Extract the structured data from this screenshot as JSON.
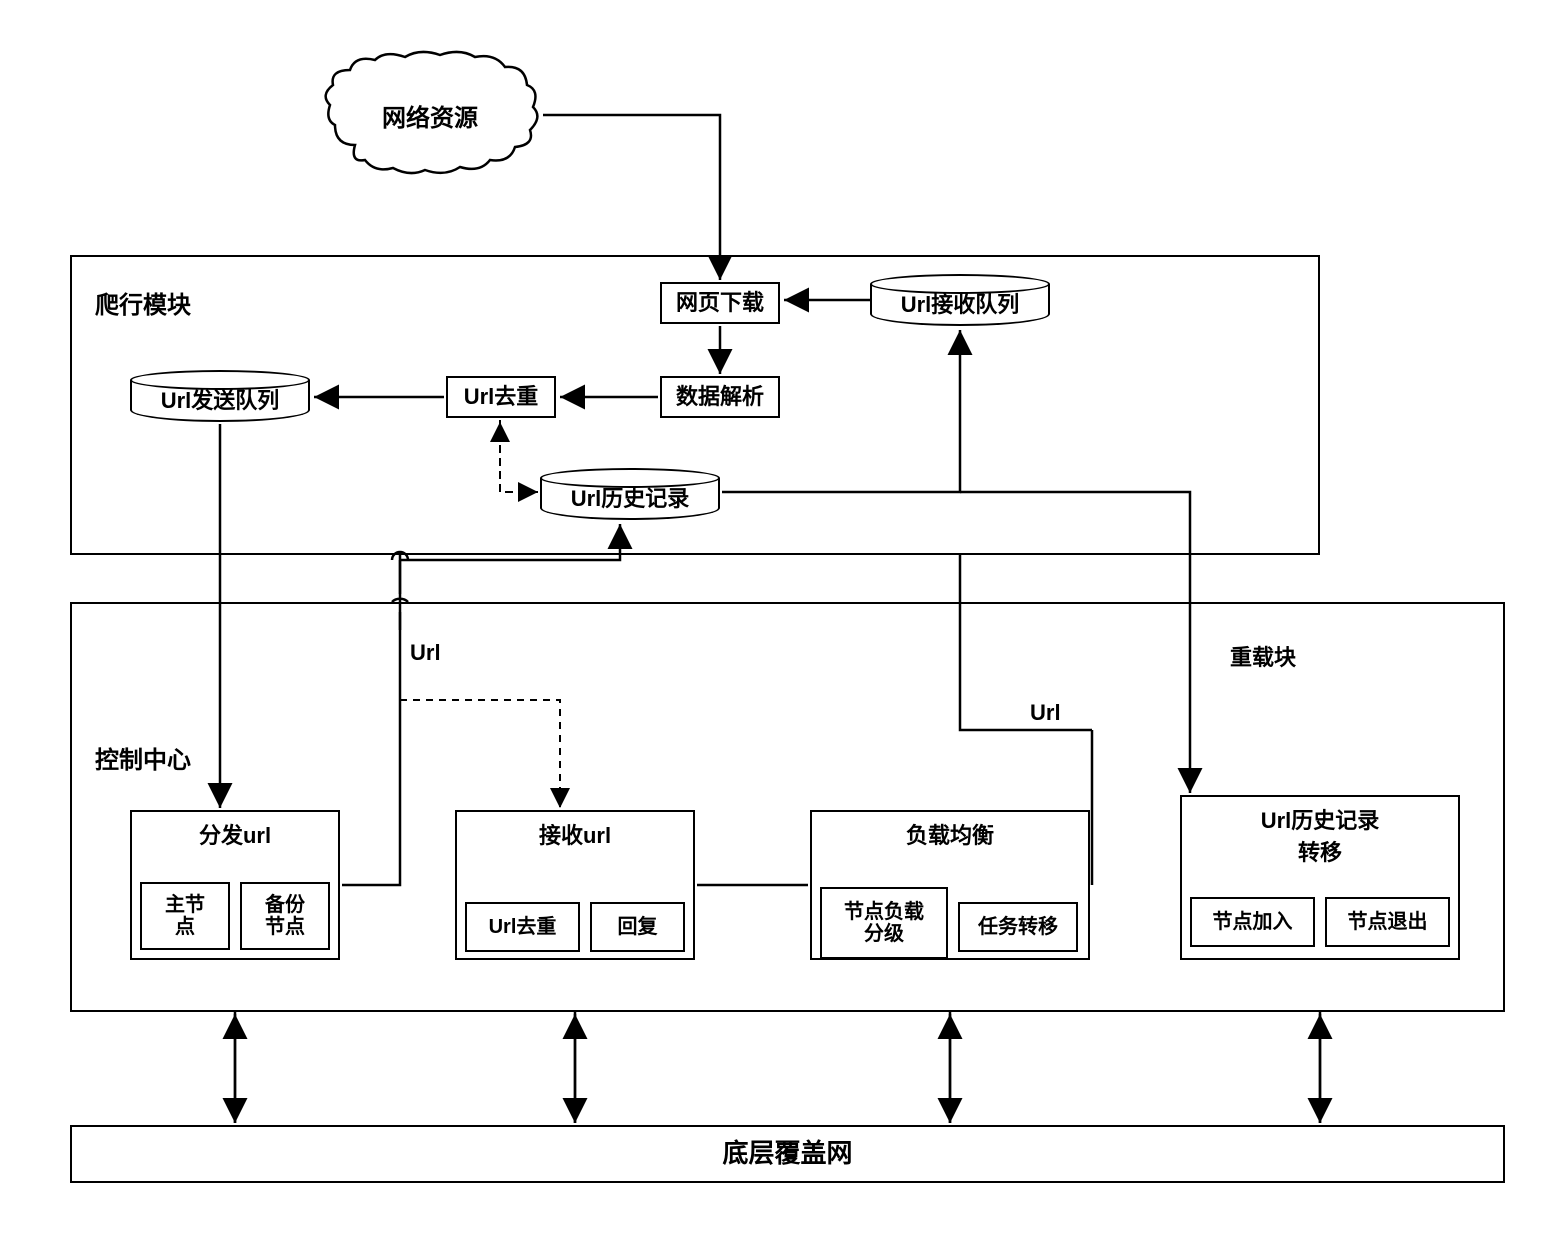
{
  "cloud": {
    "label": "网络资源"
  },
  "crawler_module": {
    "title": "爬行模块",
    "web_download": "网页下载",
    "data_parse": "数据解析",
    "url_dedup": "Url去重",
    "url_send_queue": "Url发送队列",
    "url_recv_queue": "Url接收队列",
    "url_history": "Url历史记录"
  },
  "control_center": {
    "title": "控制中心",
    "url_label1": "Url",
    "url_label2": "Url",
    "reload_block": "重载块",
    "dispatch": {
      "title": "分发url",
      "master": "主节\n点",
      "backup": "备份\n节点"
    },
    "receive": {
      "title": "接收url",
      "dedup": "Url去重",
      "reply": "回复"
    },
    "load_balance": {
      "title": "负载均衡",
      "level": "节点负载\n分级",
      "transfer": "任务转移"
    },
    "history_transfer": {
      "title": "Url历史记录\n转移",
      "join": "节点加入",
      "exit": "节点退出"
    }
  },
  "overlay": {
    "label": "底层覆盖网"
  }
}
